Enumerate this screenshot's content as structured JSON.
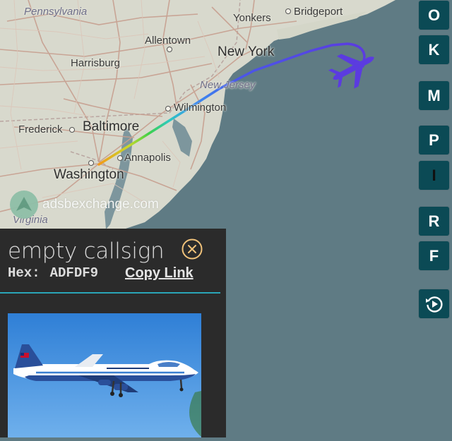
{
  "map": {
    "places": [
      {
        "id": "pennsylvania",
        "label": "Pennsylvania"
      },
      {
        "id": "yonkers",
        "label": "Yonkers"
      },
      {
        "id": "bridgeport",
        "label": "Bridgeport"
      },
      {
        "id": "allentown",
        "label": "Allentown"
      },
      {
        "id": "new-york",
        "label": "New York"
      },
      {
        "id": "harrisburg",
        "label": "Harrisburg"
      },
      {
        "id": "new-jersey",
        "label": "New Jersey"
      },
      {
        "id": "wilmington",
        "label": "Wilmington"
      },
      {
        "id": "frederick",
        "label": "Frederick"
      },
      {
        "id": "baltimore",
        "label": "Baltimore"
      },
      {
        "id": "annapolis",
        "label": "Annapolis"
      },
      {
        "id": "washington",
        "label": "Washington"
      },
      {
        "id": "virginia",
        "label": "Virginia"
      }
    ],
    "watermark": "adsbexchange.com",
    "aircraft_icon": "airliner-icon",
    "colors": {
      "water": "#5f7b84",
      "land": "#d7d8cc",
      "aircraft": "#5b3be0",
      "track_start": "#f28a1e",
      "track_end": "#5b3be0"
    }
  },
  "side_buttons": [
    "O",
    "K",
    "M",
    "P",
    "I",
    "R",
    "F"
  ],
  "replay_icon": "replay-icon",
  "info_panel": {
    "callsign": "empty callsign",
    "hex_label": "Hex:",
    "hex_value": "ADFDF9",
    "copy_link": "Copy Link",
    "close_icon": "close-icon",
    "accent": "#2aa6b8"
  }
}
